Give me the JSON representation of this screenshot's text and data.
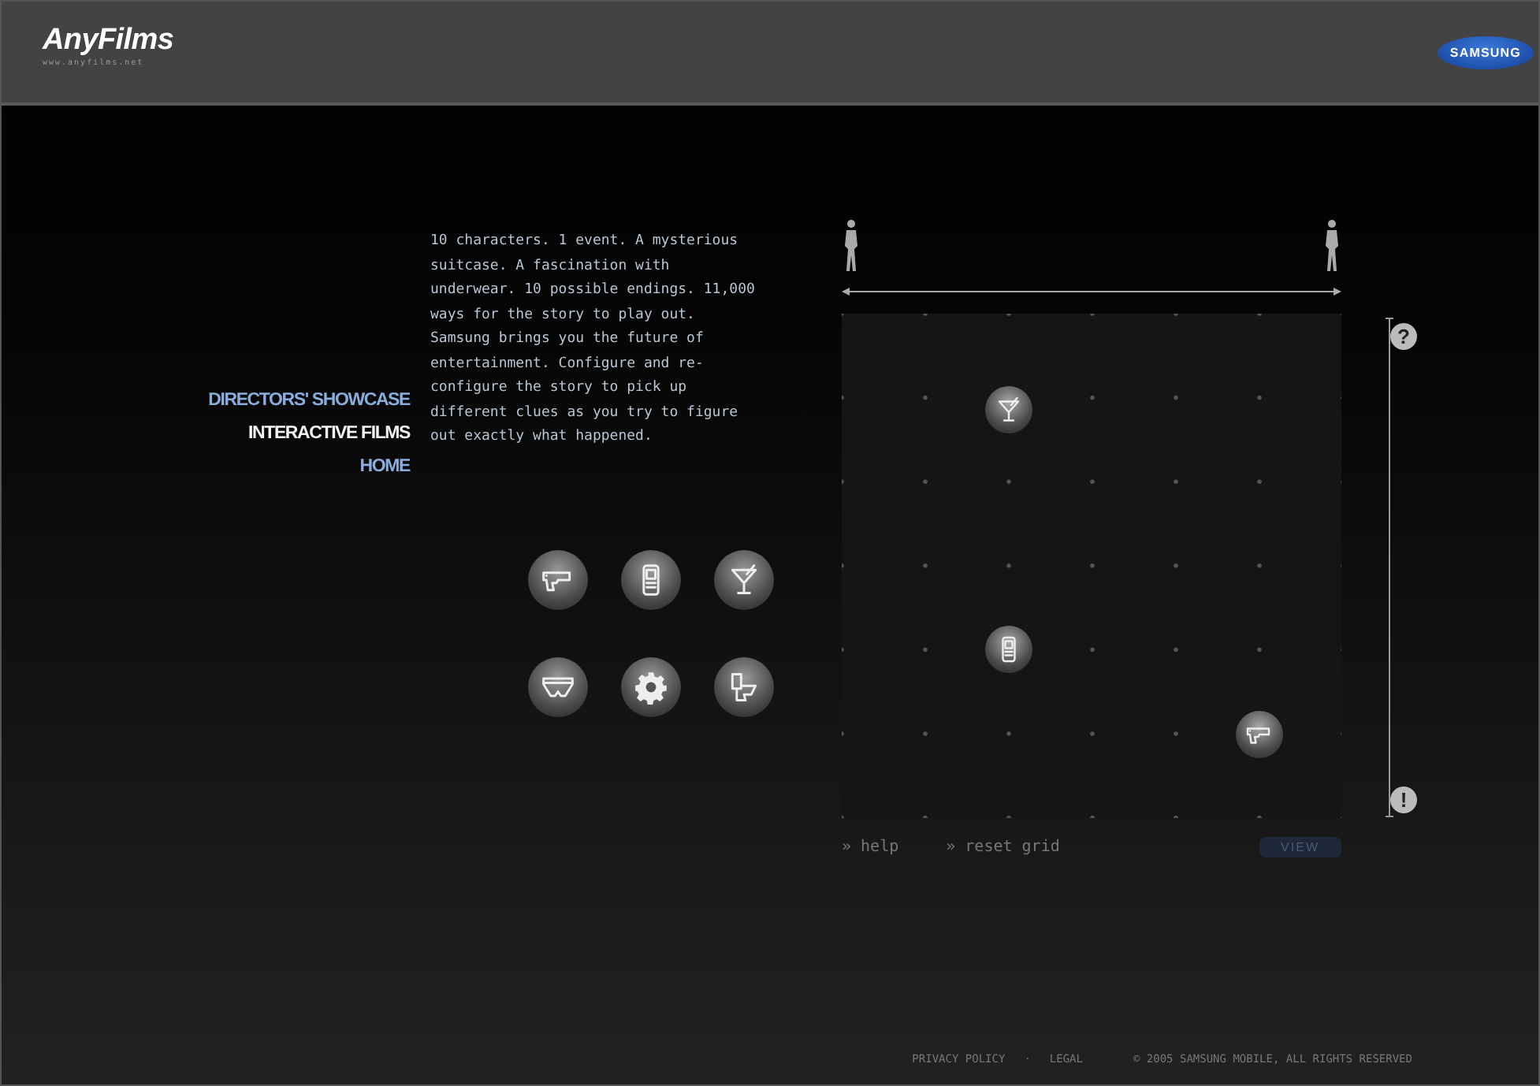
{
  "header": {
    "logo": "AnyFilms",
    "logo_url": "www.anyfilms.net",
    "brand": "SAMSUNG"
  },
  "nav": [
    {
      "label": "DIRECTORS' SHOWCASE",
      "selected": false
    },
    {
      "label": "INTERACTIVE FILMS",
      "selected": true
    },
    {
      "label": "HOME",
      "selected": false
    }
  ],
  "description": "10 characters. 1 event. A mysterious suitcase. A fascination with underwear. 10 possible endings. 11,000 ways for the story to play out. Samsung brings you the future of entertainment. Configure and re-configure the story to pick up different clues as you try to figure out exactly what happened.",
  "clues": [
    {
      "kind": "pistol"
    },
    {
      "kind": "phone"
    },
    {
      "kind": "cocktail"
    },
    {
      "kind": "underwear"
    },
    {
      "kind": "gear"
    },
    {
      "kind": "toilet"
    }
  ],
  "grid": {
    "tokens": [
      {
        "kind": "cocktail"
      },
      {
        "kind": "phone"
      },
      {
        "kind": "pistol"
      }
    ],
    "top_mark": "?",
    "bottom_mark": "!",
    "links": [
      "» help",
      "» reset grid"
    ],
    "view_button": "VIEW"
  },
  "footer": {
    "links": [
      "PRIVACY POLICY",
      "LEGAL"
    ],
    "separator": "·",
    "copyright": "© 2005 SAMSUNG MOBILE, ALL RIGHTS RESERVED"
  }
}
